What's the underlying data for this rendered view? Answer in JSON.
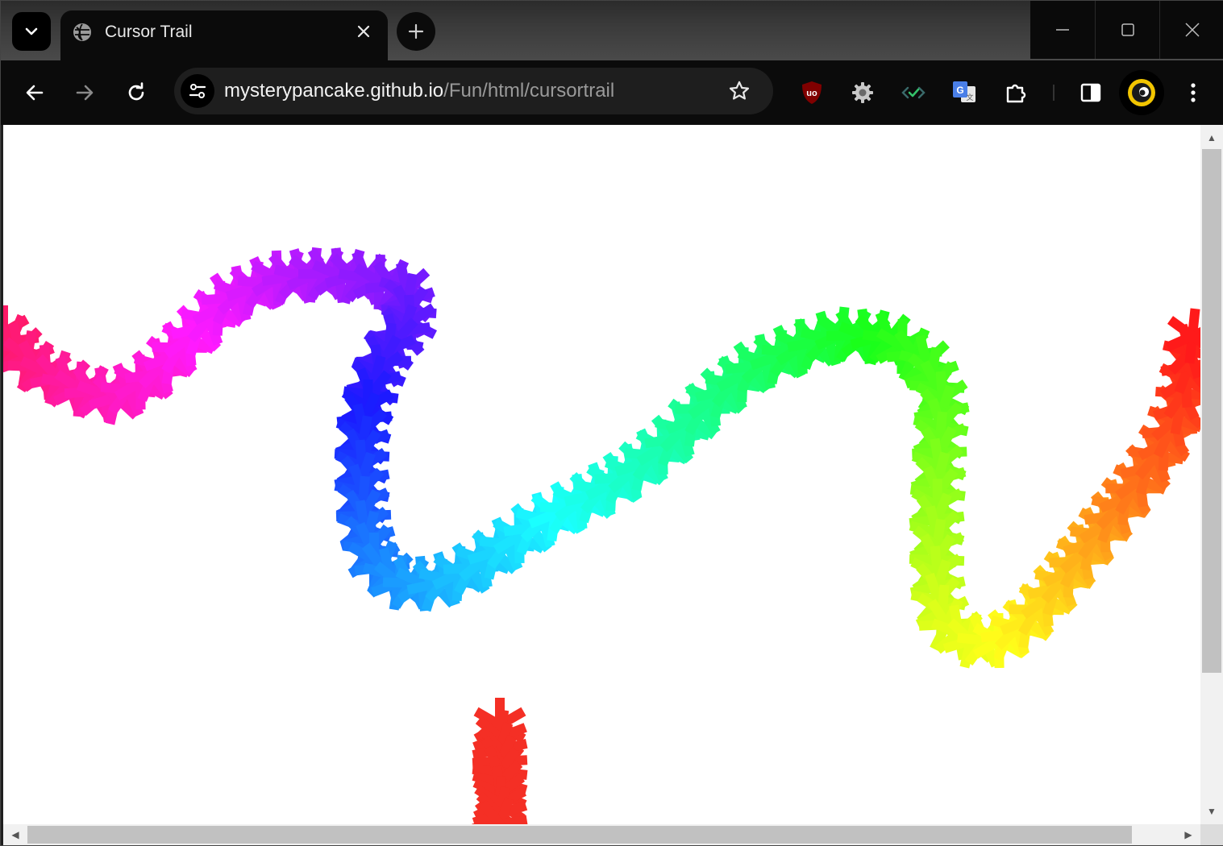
{
  "tab": {
    "title": "Cursor Trail",
    "search_icon": "chevron-down-icon",
    "close_icon": "close-icon"
  },
  "new_tab_icon": "plus-icon",
  "window_controls": {
    "minimize_icon": "minimize-icon",
    "maximize_icon": "maximize-icon",
    "close_icon": "close-icon"
  },
  "toolbar": {
    "back_icon": "arrow-left-icon",
    "forward_icon": "arrow-right-icon",
    "reload_icon": "reload-icon",
    "site_info_icon": "tune-icon",
    "bookmark_icon": "star-icon"
  },
  "url": {
    "host": "mysterypancake.github.io",
    "path": "/Fun/html/cursortrail"
  },
  "extensions": [
    {
      "name": "ublock-icon"
    },
    {
      "name": "gear-icon"
    },
    {
      "name": "code-check-icon"
    },
    {
      "name": "translate-icon"
    },
    {
      "name": "puzzle-icon"
    }
  ],
  "side_panel_icon": "side-panel-icon",
  "profile_icon": "profile-icon",
  "menu_icon": "more-vertical-icon",
  "accent_colors": {
    "tab_active": "#0b0b0b",
    "toolbar": "#0b0b0b",
    "omnibox": "#1e1e1e",
    "ublock": "#8b0000",
    "profile_ring": "#f2c500"
  },
  "trail": {
    "shape": "asterisk",
    "colors_by_hue": true,
    "hue_start": 340,
    "hue_direction": "decreasing",
    "segment_count": 2
  }
}
